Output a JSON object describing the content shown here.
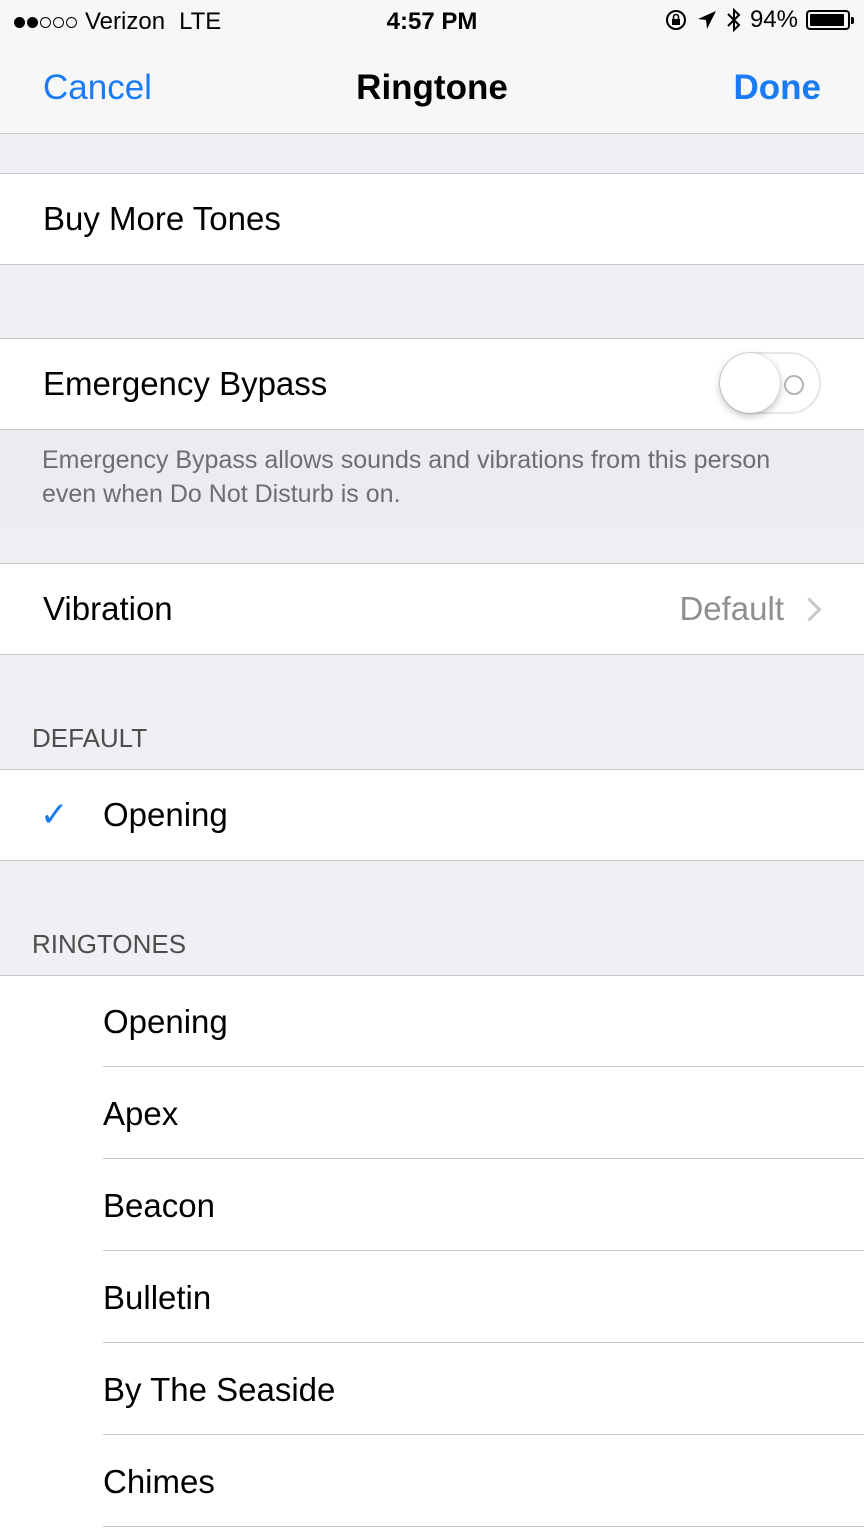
{
  "status_bar": {
    "carrier": "Verizon",
    "network": "LTE",
    "time": "4:57 PM",
    "battery": "94%",
    "battery_level": 0.94,
    "signal_bars_filled": 2,
    "signal_bars_total": 5
  },
  "nav": {
    "cancel_label": "Cancel",
    "title": "Ringtone",
    "done_label": "Done"
  },
  "store": {
    "buy_more_label": "Buy More Tones"
  },
  "emergency": {
    "label": "Emergency Bypass",
    "enabled": false,
    "footer": "Emergency Bypass allows sounds and vibrations from this person even when Do Not Disturb is on."
  },
  "vibration": {
    "label": "Vibration",
    "value": "Default"
  },
  "default_section": {
    "header": "DEFAULT",
    "selected": "Opening"
  },
  "ringtones_section": {
    "header": "RINGTONES",
    "items": [
      "Opening",
      "Apex",
      "Beacon",
      "Bulletin",
      "By The Seaside",
      "Chimes"
    ]
  },
  "colors": {
    "accent": "#1a7cf5",
    "background": "#efeff4",
    "separator": "#c8c7cc",
    "secondary_text": "#8e8e93"
  }
}
